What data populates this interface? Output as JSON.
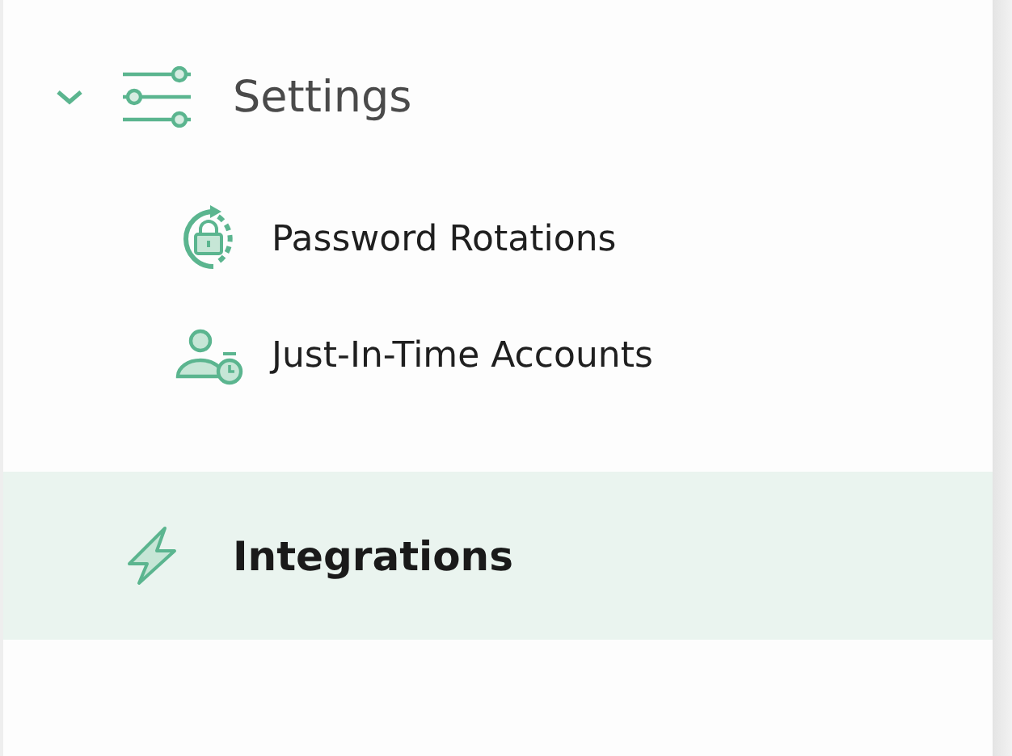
{
  "nav": [
    {
      "label": "Settings",
      "kind": "sliders",
      "expanded": true,
      "selected": false,
      "children": [
        {
          "label": "Password Rotations",
          "kind": "rotation",
          "selected": false
        },
        {
          "label": "Just-In-Time Accounts",
          "kind": "user-clock",
          "selected": false
        }
      ]
    },
    {
      "label": "Integrations",
      "kind": "bolt",
      "selected": true
    }
  ]
}
